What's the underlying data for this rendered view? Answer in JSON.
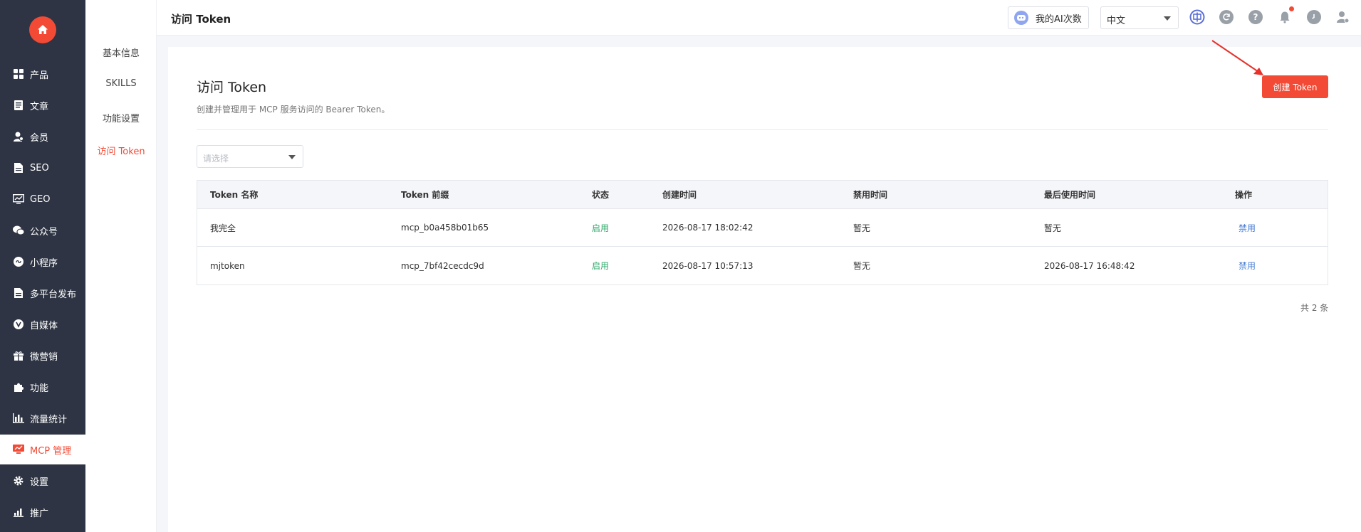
{
  "topbar": {
    "title": "访问 Token",
    "ai_button_label": "我的AI次数",
    "lang_selected": "中文"
  },
  "nav": {
    "items": [
      {
        "label": "产品",
        "icon": "grid-icon"
      },
      {
        "label": "文章",
        "icon": "document-icon"
      },
      {
        "label": "会员",
        "icon": "member-icon"
      },
      {
        "label": "SEO",
        "icon": "seo-file-icon"
      },
      {
        "label": "GEO",
        "icon": "monitor-chart-icon"
      },
      {
        "label": "公众号",
        "icon": "wechat-icon"
      },
      {
        "label": "小程序",
        "icon": "miniprogram-icon"
      },
      {
        "label": "多平台发布",
        "icon": "publish-file-icon"
      },
      {
        "label": "自媒体",
        "icon": "media-icon"
      },
      {
        "label": "微营销",
        "icon": "gift-icon"
      },
      {
        "label": "功能",
        "icon": "puzzle-icon"
      },
      {
        "label": "流量统计",
        "icon": "bar-chart-icon"
      },
      {
        "label": "MCP 管理",
        "icon": "mcp-icon"
      },
      {
        "label": "设置",
        "icon": "gear-icon"
      },
      {
        "label": "推广",
        "icon": "promote-chart-icon"
      }
    ]
  },
  "subnav": {
    "items": [
      {
        "label": "基本信息"
      },
      {
        "label": "SKILLS"
      },
      {
        "label": "功能设置"
      },
      {
        "label": "访问 Token"
      }
    ]
  },
  "main": {
    "title": "访问 Token",
    "description": "创建并管理用于 MCP 服务访问的 Bearer Token。",
    "create_button": "创建 Token",
    "filter_placeholder": "请选择",
    "table": {
      "headers": [
        "Token 名称",
        "Token 前缀",
        "状态",
        "创建时间",
        "禁用时间",
        "最后使用时间",
        "操作"
      ],
      "rows": [
        [
          "我完全",
          "mcp_b0a458b01b65",
          "启用",
          "2026-08-17 18:02:42",
          "暂无",
          "暂无",
          "禁用"
        ],
        [
          "mjtoken",
          "mcp_7bf42cecdc9d",
          "启用",
          "2026-08-17 10:57:13",
          "暂无",
          "2026-08-17 16:48:42",
          "禁用"
        ]
      ]
    },
    "total": "共 2 条"
  },
  "colors": {
    "accent": "#f24a35",
    "sidebar_bg": "#2e3443",
    "status_enabled": "#2fa86b",
    "link": "#4a7fd4"
  }
}
